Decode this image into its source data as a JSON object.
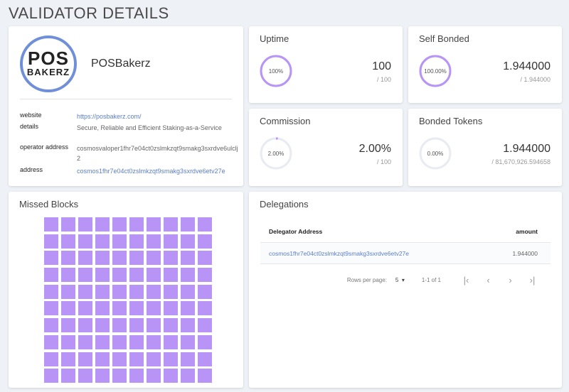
{
  "page": {
    "title": "VALIDATOR DETAILS"
  },
  "validator": {
    "logo_line1": "POS",
    "logo_line2": "BAKERZ",
    "moniker": "POSBakerz",
    "website_label": "website",
    "website": "https://posbakerz.com/",
    "details_label": "details",
    "details": "Secure, Reliable and Efficient Staking-as-a-Service",
    "operator_label": "operator address",
    "operator_address": "cosmosvaloper1fhr7e04ct0zslmkzqt9smakg3sxrdve6ulclj2",
    "address_label": "address",
    "address": "cosmos1fhr7e04ct0zslmkzqt9smakg3sxrdve6etv27e"
  },
  "stats": {
    "uptime": {
      "title": "Uptime",
      "ring_label": "100%",
      "percent": 100,
      "value": "100",
      "total": "/ 100"
    },
    "self_bonded": {
      "title": "Self Bonded",
      "ring_label": "100.00%",
      "percent": 100,
      "value": "1.944000",
      "total": "/ 1.944000"
    },
    "commission": {
      "title": "Commission",
      "ring_label": "2.00%",
      "percent": 2,
      "value": "2.00%",
      "total": "/ 100"
    },
    "bonded_tokens": {
      "title": "Bonded Tokens",
      "ring_label": "0.00%",
      "percent": 0,
      "value": "1.944000",
      "total": "/ 81,670,926.594658"
    }
  },
  "colors": {
    "accent": "#b794f6",
    "ring_track": "#e8ebf1",
    "link": "#5b7ec9"
  },
  "missed_blocks": {
    "title": "Missed Blocks",
    "block_count": 100
  },
  "delegations": {
    "title": "Delegations",
    "columns": {
      "address": "Delegator Address",
      "amount": "amount"
    },
    "rows": [
      {
        "address": "cosmos1fhr7e04ct0zslmkzqt9smakg3sxrdve6etv27e",
        "amount": "1.944000"
      }
    ],
    "pagination": {
      "rows_per_page_label": "Rows per page:",
      "rows_per_page": "5",
      "range": "1-1 of 1",
      "first_icon": "first-page-icon",
      "prev_icon": "chevron-left-icon",
      "next_icon": "chevron-right-icon",
      "last_icon": "last-page-icon"
    }
  }
}
